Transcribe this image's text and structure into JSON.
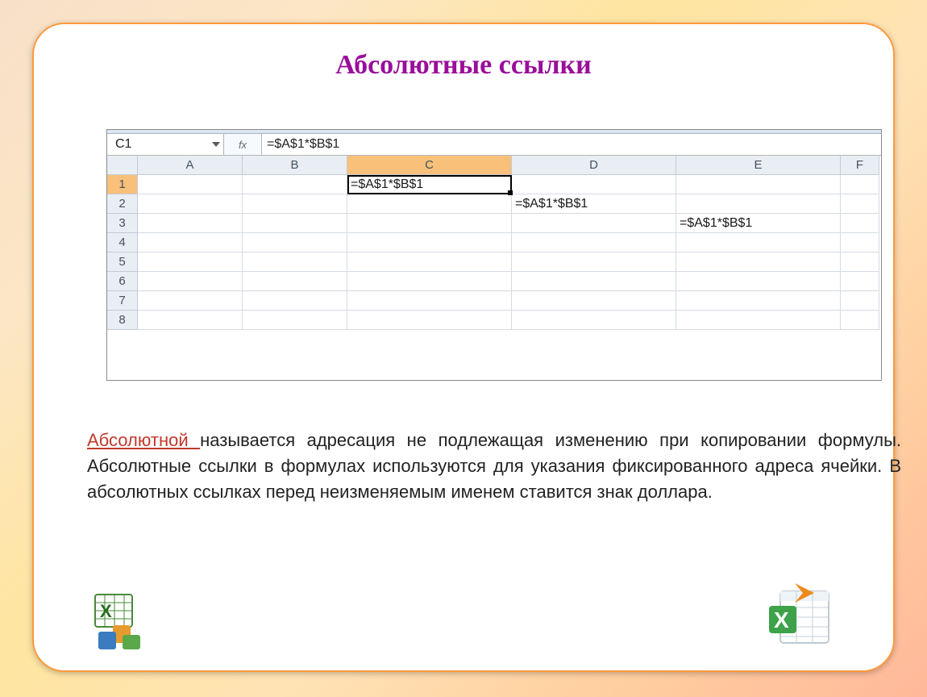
{
  "title": "Абсолютные ссылки",
  "namebox": "C1",
  "fxlabel": "fx",
  "formula": "=$A$1*$B$1",
  "columns": [
    "A",
    "B",
    "C",
    "D",
    "E",
    "F"
  ],
  "rows": [
    "1",
    "2",
    "3",
    "4",
    "5",
    "6",
    "7",
    "8"
  ],
  "cells": {
    "C1": "=$A$1*$B$1",
    "D2": "=$A$1*$B$1",
    "E3": "=$A$1*$B$1"
  },
  "para_kw": "Абсолютной ",
  "para_rest": "называется адресация не подлежащая изменению при копировании формулы. Абсолютные ссылки в формулах используются для указания фиксированного адреса ячейки. В абсолютных ссылках перед неизменяемым именем ставится знак доллара."
}
